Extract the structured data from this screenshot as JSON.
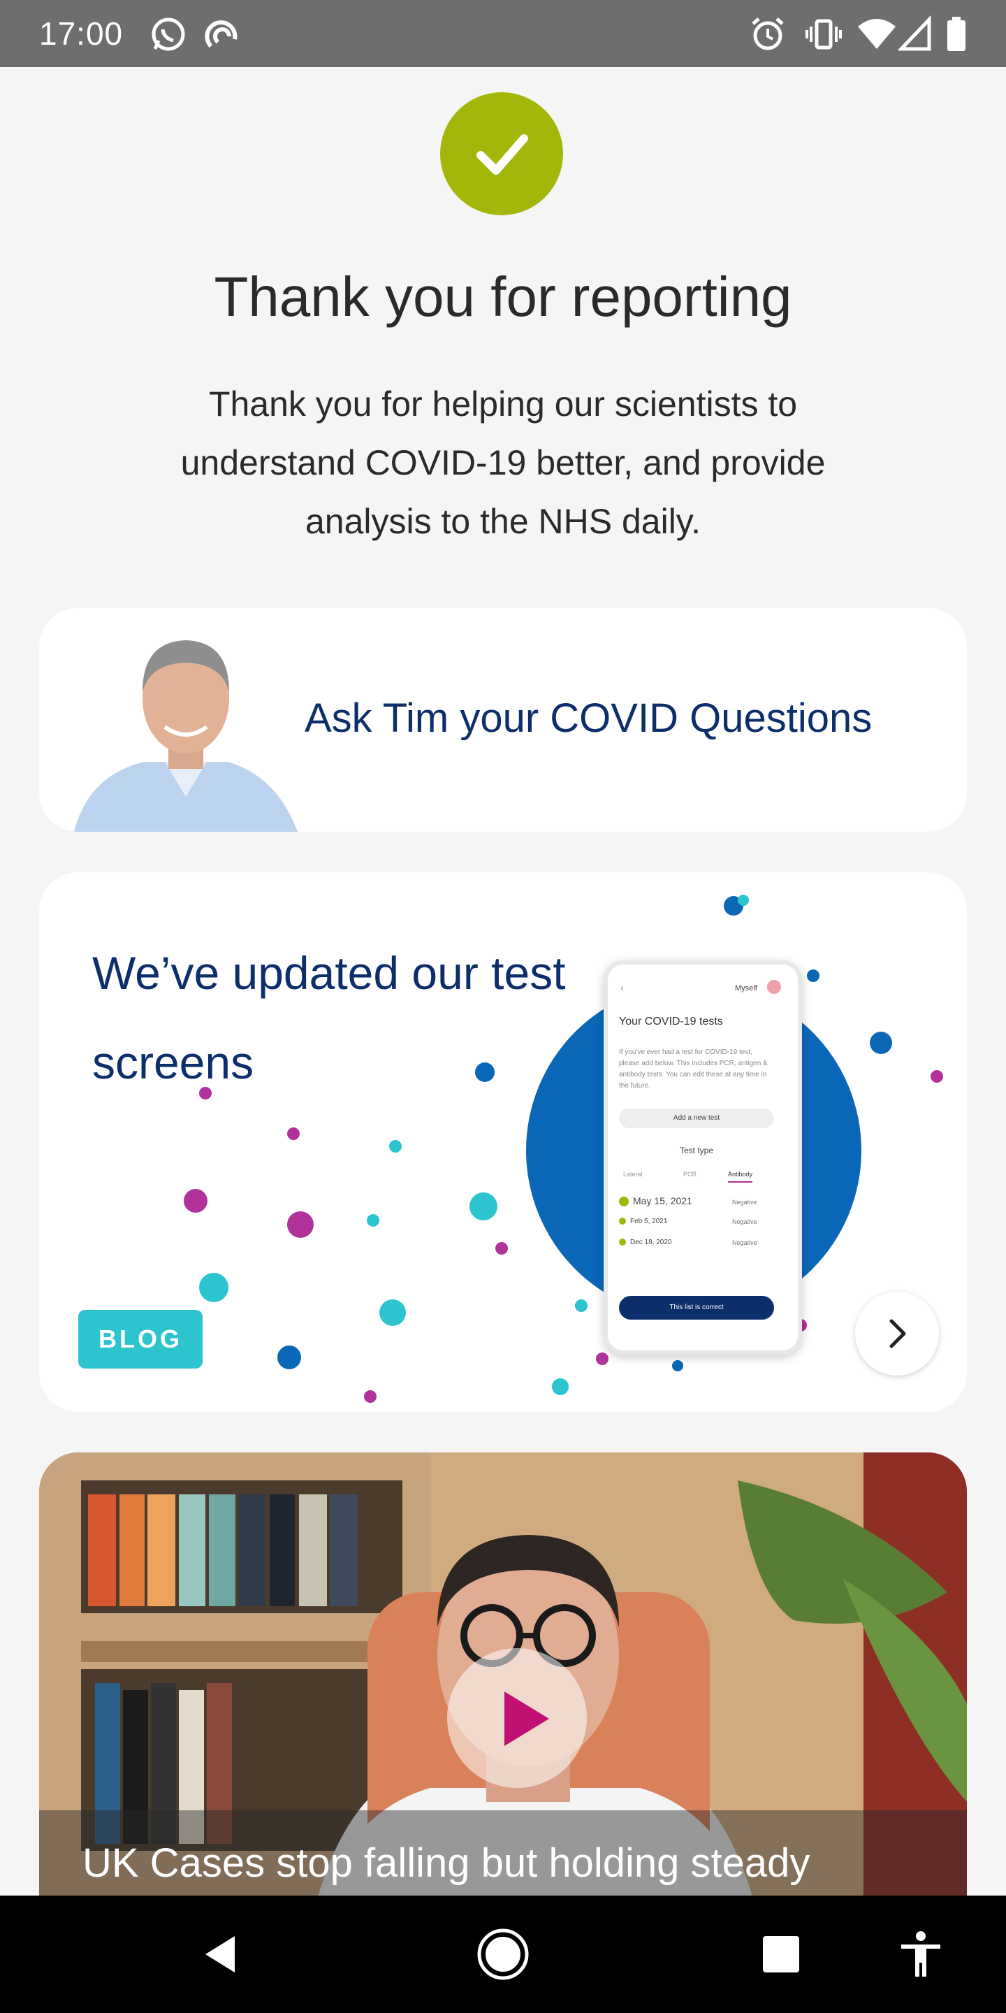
{
  "status_bar": {
    "time": "17:00",
    "left_icons": [
      "whatsapp-icon",
      "sync-icon"
    ],
    "right_icons": [
      "alarm-icon",
      "vibrate-icon",
      "wifi-icon",
      "signal-icon",
      "battery-icon"
    ]
  },
  "confirmation": {
    "icon": "check-icon",
    "accent_color": "#a2b70a",
    "title": "Thank you for reporting",
    "message": "Thank you for helping our scientists to understand COVID-19 better, and provide analysis to the NHS daily."
  },
  "cards": {
    "ask_tim": {
      "label": "Ask Tim your COVID Questions"
    },
    "blog": {
      "title": "We’ve updated our test screens",
      "badge": "BLOG",
      "phone_preview": {
        "profile": "Myself",
        "heading": "Your COVID-19 tests",
        "body": "If you've ever had a test for COVID-19 test, please add below. This includes PCR, antigen & antibody tests. You can edit these at any time in the future.",
        "add_button": "Add a new test",
        "section_label": "Test type",
        "tabs": [
          "Lateral",
          "PCR",
          "Antibody"
        ],
        "results": [
          {
            "date": "May 15, 2021",
            "result": "Negative"
          },
          {
            "date": "Feb 5, 2021",
            "result": "Negative"
          },
          {
            "date": "Dec 18, 2020",
            "result": "Negative"
          }
        ],
        "confirm_button": "This list is correct"
      }
    },
    "video": {
      "caption": "UK Cases stop falling but holding steady"
    }
  },
  "colors": {
    "navy": "#0c2f6b",
    "teal": "#2cc4cf",
    "blue": "#0a67b8",
    "magenta": "#b0329a"
  }
}
